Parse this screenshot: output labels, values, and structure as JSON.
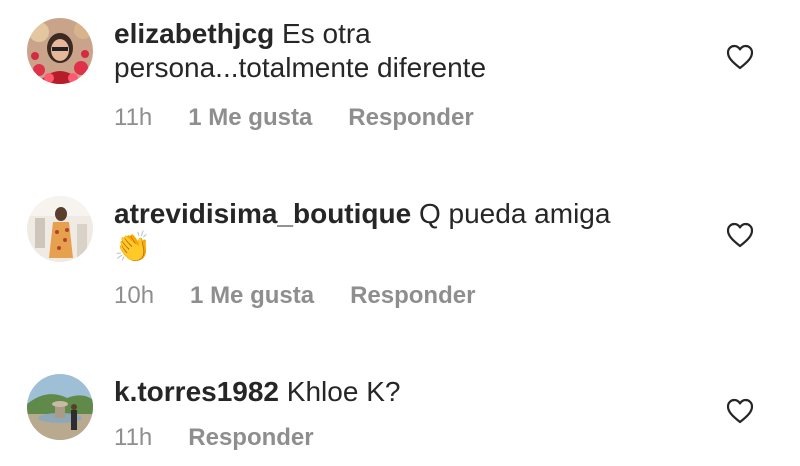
{
  "comments": [
    {
      "username": "elizabethjcg",
      "text_line1": " Es otra",
      "text_line2": "persona...totalmente diferente",
      "time": "11h",
      "likes": "1 Me gusta",
      "reply": "Responder"
    },
    {
      "username": "atrevidisima_boutique",
      "text_line1": " Q pueda amiga",
      "emoji": "👏",
      "time": "10h",
      "likes": "1 Me gusta",
      "reply": "Responder"
    },
    {
      "username": "k.torres1982",
      "text_line1": " Khloe K?",
      "time": "11h",
      "reply": "Responder"
    }
  ]
}
